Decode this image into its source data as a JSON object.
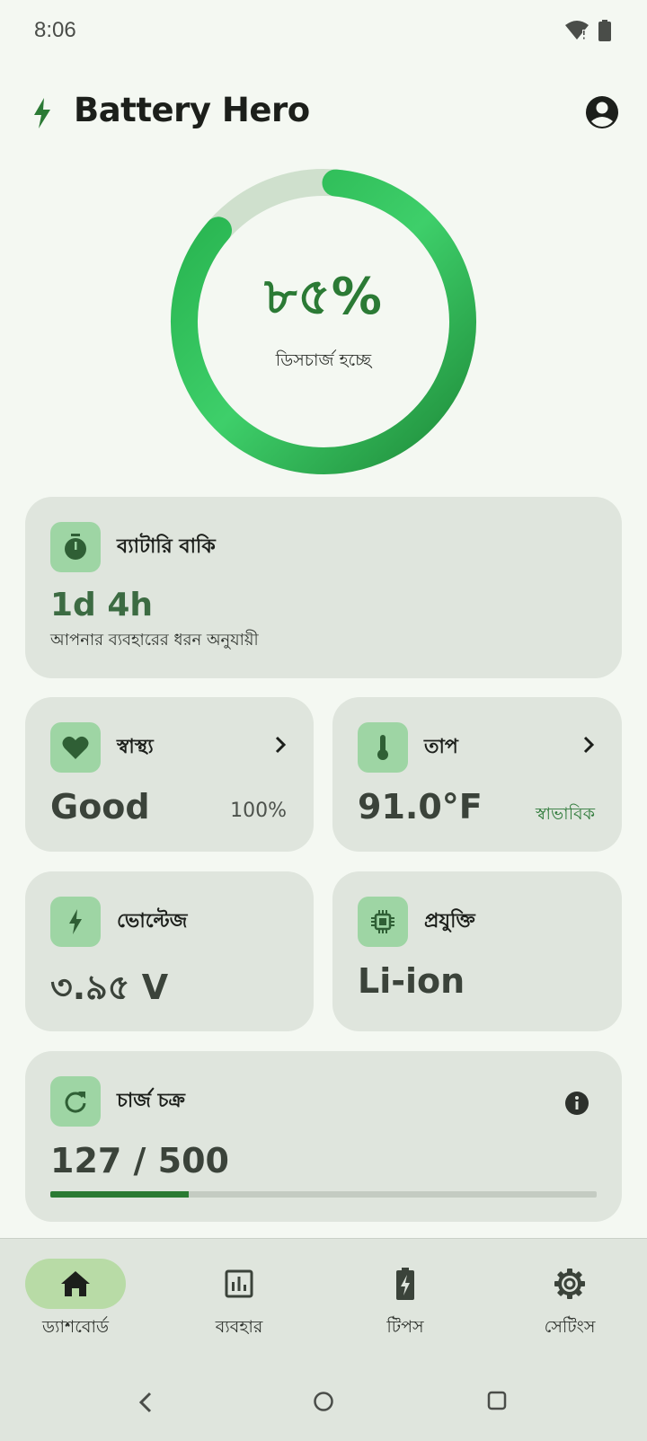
{
  "status_bar": {
    "time": "8:06",
    "icons": [
      "wifi-alert-icon",
      "battery-icon"
    ]
  },
  "header": {
    "title": "Battery Hero",
    "logo_icon": "bolt-icon",
    "account_icon": "account-circle-icon"
  },
  "gauge": {
    "percent_label": "৮৫%",
    "level": 0.85,
    "status": "ডিসচার্জ হচ্ছে"
  },
  "remaining": {
    "title": "ব্যাটারি বাকি",
    "value": "1d 4h",
    "subtitle": "আপনার ব্যবহারের ধরন অনুযায়ী",
    "icon": "timer-icon"
  },
  "health": {
    "title": "স্বাস্থ্য",
    "value": "Good",
    "percent": "100%",
    "icon": "heart-icon"
  },
  "temperature": {
    "title": "তাপ",
    "value": "91.0°F",
    "state": "স্বাভাবিক",
    "icon": "thermometer-icon"
  },
  "voltage": {
    "title": "ভোল্টেজ",
    "value": "৩.৯৫ V",
    "icon": "bolt-icon"
  },
  "technology": {
    "title": "প্রযুক্তি",
    "value": "Li-ion",
    "icon": "chip-icon"
  },
  "cycles": {
    "title": "চার্জ চক্র",
    "value": "127 / 500",
    "progress": 0.254,
    "icon": "refresh-icon"
  },
  "nav": {
    "items": [
      {
        "label": "ড্যাশবোর্ড",
        "icon": "home-icon",
        "active": true
      },
      {
        "label": "ব্যবহার",
        "icon": "bar-chart-icon",
        "active": false
      },
      {
        "label": "টিপস",
        "icon": "battery-charging-icon",
        "active": false
      },
      {
        "label": "সেটিংস",
        "icon": "settings-icon",
        "active": false
      }
    ]
  },
  "colors": {
    "accent": "#2b7a35",
    "card": "#dfe5dd",
    "tile": "#9ed5a4",
    "background": "#f4f8f2"
  }
}
